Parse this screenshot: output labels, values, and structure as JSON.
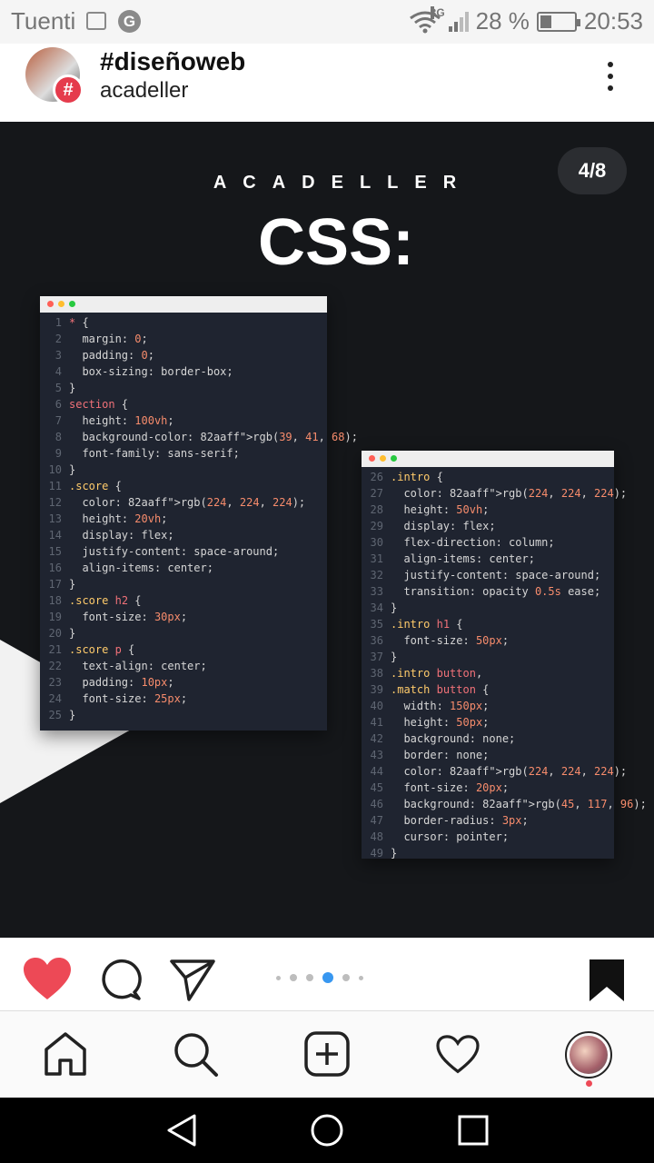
{
  "status_bar": {
    "carrier": "Tuenti",
    "network": "3G",
    "roaming": "R",
    "battery": "28 %",
    "time": "20:53"
  },
  "post": {
    "title": "#diseñoweb",
    "subtitle": "acadeller",
    "badge": "#"
  },
  "slide": {
    "counter": "4/8",
    "brand": "ACADELLER",
    "heading": "CSS:",
    "dots_total": 6,
    "dots_active_index": 3
  },
  "colors": {
    "accent_blue": "#3897f0",
    "heart_red": "#ed4956",
    "code_bg": "#1f2430",
    "code_keyword": "#f07178",
    "code_selector": "#ffcb6b",
    "code_number": "#f78c6c",
    "code_function": "#82aaff",
    "code_property": "#d6d6d6"
  },
  "code_left": [
    {
      "n": "1",
      "t": "* {"
    },
    {
      "n": "2",
      "t": "  margin: 0;"
    },
    {
      "n": "3",
      "t": "  padding: 0;"
    },
    {
      "n": "4",
      "t": "  box-sizing: border-box;"
    },
    {
      "n": "5",
      "t": "}"
    },
    {
      "n": "6",
      "t": "section {"
    },
    {
      "n": "7",
      "t": "  height: 100vh;"
    },
    {
      "n": "8",
      "t": "  background-color: rgb(39, 41, 68);"
    },
    {
      "n": "9",
      "t": "  font-family: sans-serif;"
    },
    {
      "n": "10",
      "t": "}"
    },
    {
      "n": "11",
      "t": ".score {"
    },
    {
      "n": "12",
      "t": "  color: rgb(224, 224, 224);"
    },
    {
      "n": "13",
      "t": "  height: 20vh;"
    },
    {
      "n": "14",
      "t": "  display: flex;"
    },
    {
      "n": "15",
      "t": "  justify-content: space-around;"
    },
    {
      "n": "16",
      "t": "  align-items: center;"
    },
    {
      "n": "17",
      "t": "}"
    },
    {
      "n": "18",
      "t": ".score h2 {"
    },
    {
      "n": "19",
      "t": "  font-size: 30px;"
    },
    {
      "n": "20",
      "t": "}"
    },
    {
      "n": "21",
      "t": ".score p {"
    },
    {
      "n": "22",
      "t": "  text-align: center;"
    },
    {
      "n": "23",
      "t": "  padding: 10px;"
    },
    {
      "n": "24",
      "t": "  font-size: 25px;"
    },
    {
      "n": "25",
      "t": "}"
    }
  ],
  "code_right": [
    {
      "n": "26",
      "t": ".intro {"
    },
    {
      "n": "27",
      "t": "  color: rgb(224, 224, 224);"
    },
    {
      "n": "28",
      "t": "  height: 50vh;"
    },
    {
      "n": "29",
      "t": "  display: flex;"
    },
    {
      "n": "30",
      "t": "  flex-direction: column;"
    },
    {
      "n": "31",
      "t": "  align-items: center;"
    },
    {
      "n": "32",
      "t": "  justify-content: space-around;"
    },
    {
      "n": "33",
      "t": "  transition: opacity 0.5s ease;"
    },
    {
      "n": "34",
      "t": "}"
    },
    {
      "n": "35",
      "t": ".intro h1 {"
    },
    {
      "n": "36",
      "t": "  font-size: 50px;"
    },
    {
      "n": "37",
      "t": "}"
    },
    {
      "n": "38",
      "t": ".intro button,"
    },
    {
      "n": "39",
      "t": ".match button {"
    },
    {
      "n": "40",
      "t": "  width: 150px;"
    },
    {
      "n": "41",
      "t": "  height: 50px;"
    },
    {
      "n": "42",
      "t": "  background: none;"
    },
    {
      "n": "43",
      "t": "  border: none;"
    },
    {
      "n": "44",
      "t": "  color: rgb(224, 224, 224);"
    },
    {
      "n": "45",
      "t": "  font-size: 20px;"
    },
    {
      "n": "46",
      "t": "  background: rgb(45, 117, 96);"
    },
    {
      "n": "47",
      "t": "  border-radius: 3px;"
    },
    {
      "n": "48",
      "t": "  cursor: pointer;"
    },
    {
      "n": "49",
      "t": "}"
    }
  ],
  "icons": {
    "like": "heart-icon",
    "comment": "comment-icon",
    "share": "send-icon",
    "save": "bookmark-icon",
    "nav_home": "home-icon",
    "nav_search": "search-icon",
    "nav_add": "add-icon",
    "nav_activity": "heart-outline-icon",
    "nav_profile": "profile-avatar"
  }
}
